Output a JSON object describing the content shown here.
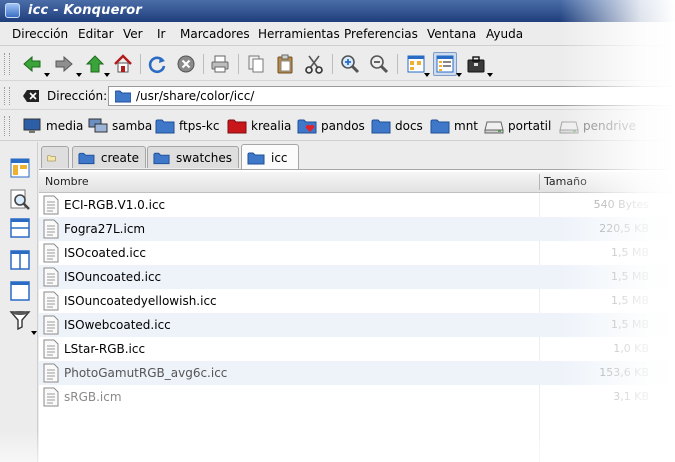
{
  "window": {
    "title": "icc - Konqueror"
  },
  "menubar": {
    "items": [
      {
        "id": "direccion",
        "label": "Dirección"
      },
      {
        "id": "editar",
        "label": "Editar"
      },
      {
        "id": "ver",
        "label": "Ver"
      },
      {
        "id": "ir",
        "label": "Ir"
      },
      {
        "id": "marcadores",
        "label": "Marcadores"
      },
      {
        "id": "herramientas",
        "label": "Herramientas"
      },
      {
        "id": "preferencias",
        "label": "Preferencias"
      },
      {
        "id": "ventana",
        "label": "Ventana"
      },
      {
        "id": "ayuda",
        "label": "Ayuda"
      }
    ]
  },
  "toolbar": {
    "icons": [
      "back-arrow-icon",
      "forward-arrow-icon",
      "up-arrow-icon",
      "home-icon",
      "reload-icon",
      "stop-icon",
      "print-icon",
      "copy-icon",
      "paste-icon",
      "cut-icon",
      "zoom-in-icon",
      "zoom-out-icon",
      "icon-view-icon",
      "detailed-view-icon",
      "briefcase-icon"
    ]
  },
  "location": {
    "label": "Dirección:",
    "value": "/usr/share/color/icc/"
  },
  "bookmarks": [
    {
      "label": "media",
      "icon": "monitor-icon"
    },
    {
      "label": "samba",
      "icon": "network-icon"
    },
    {
      "label": "ftps-kc",
      "icon": "folder-icon"
    },
    {
      "label": "krealia",
      "icon": "red-folder-icon"
    },
    {
      "label": "pandos",
      "icon": "heart-folder-icon"
    },
    {
      "label": "docs",
      "icon": "folder-icon"
    },
    {
      "label": "mnt",
      "icon": "folder-icon"
    },
    {
      "label": "portatil",
      "icon": "drive-icon"
    },
    {
      "label": "pendrive",
      "icon": "drive-icon"
    }
  ],
  "tabs": [
    {
      "label": "",
      "icon": "empty-tab-icon"
    },
    {
      "label": "create",
      "icon": "folder-icon"
    },
    {
      "label": "swatches",
      "icon": "folder-icon"
    },
    {
      "label": "icc",
      "icon": "folder-icon",
      "active": true
    }
  ],
  "list": {
    "columns": {
      "name": "Nombre",
      "size": "Tamaño"
    },
    "rows": [
      {
        "name": "ECI-RGB.V1.0.icc",
        "size": "540 Bytes"
      },
      {
        "name": "Fogra27L.icm",
        "size": "220,5 KB"
      },
      {
        "name": "ISOcoated.icc",
        "size": "1,5 MB"
      },
      {
        "name": "ISOuncoated.icc",
        "size": "1,5 MB"
      },
      {
        "name": "ISOuncoatedyellowish.icc",
        "size": "1,5 MB"
      },
      {
        "name": "ISOwebcoated.icc",
        "size": "1,5 MB"
      },
      {
        "name": "LStar-RGB.icc",
        "size": "1,0 KB"
      },
      {
        "name": "PhotoGamutRGB_avg6c.icc",
        "size": "153,6 KB"
      },
      {
        "name": "sRGB.icm",
        "size": "3,1 KB"
      }
    ]
  },
  "colors": {
    "titlebar": "#2c4f8f",
    "folder": "#3f78c8",
    "row_alt": "#eef3fa"
  }
}
